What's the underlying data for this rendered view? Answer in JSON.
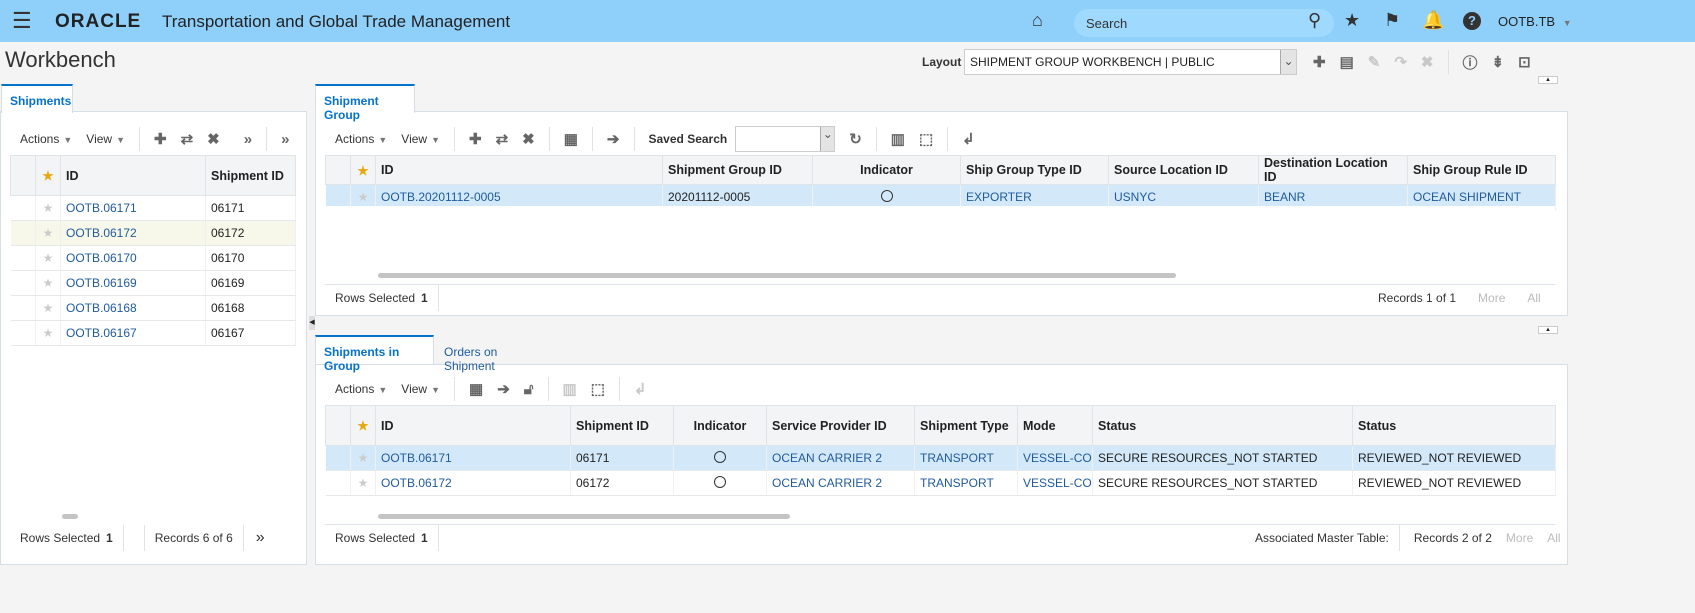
{
  "header": {
    "app_name": "Transportation and Global Trade Management",
    "logo": "ORACLE",
    "search_placeholder": "Search",
    "user": "OOTB.TB",
    "icons": [
      "menu-icon",
      "home-icon",
      "search-icon",
      "star-icon",
      "flag-icon",
      "bell-icon",
      "help-icon"
    ]
  },
  "page": {
    "title": "Workbench",
    "layout_label": "Layout",
    "layout_value": "SHIPMENT GROUP WORKBENCH | PUBLIC"
  },
  "left": {
    "tab": "Shipments",
    "actions": "Actions",
    "view": "View",
    "columns": [
      "ID",
      "Shipment ID"
    ],
    "rows": [
      [
        "OOTB.06171",
        "06171"
      ],
      [
        "OOTB.06172",
        "06172"
      ],
      [
        "OOTB.06170",
        "06170"
      ],
      [
        "OOTB.06169",
        "06169"
      ],
      [
        "OOTB.06168",
        "06168"
      ],
      [
        "OOTB.06167",
        "06167"
      ]
    ],
    "rows_selected_label": "Rows Selected",
    "rows_selected": "1",
    "records": "Records 6 of 6"
  },
  "group": {
    "tab": "Shipment Group",
    "actions": "Actions",
    "view": "View",
    "saved_search": "Saved Search",
    "columns": [
      "ID",
      "Shipment Group ID",
      "Indicator",
      "Ship Group Type ID",
      "Source Location ID",
      "Destination Location ID",
      "Ship Group Rule ID"
    ],
    "rows": [
      [
        "OOTB.20201112-0005",
        "20201112-0005",
        "",
        "EXPORTER",
        "USNYC",
        "BEANR",
        "OCEAN SHIPMENT"
      ]
    ],
    "rows_selected_label": "Rows Selected",
    "rows_selected": "1",
    "records": "Records 1 of 1",
    "more": "More",
    "all": "All"
  },
  "ingroup": {
    "tabs": [
      "Shipments in Group",
      "Orders on Shipment"
    ],
    "actions": "Actions",
    "view": "View",
    "columns": [
      "ID",
      "Shipment ID",
      "Indicator",
      "Service Provider ID",
      "Shipment Type",
      "Mode",
      "Status",
      "Status"
    ],
    "rows": [
      [
        "OOTB.06171",
        "06171",
        "",
        "OCEAN CARRIER 2",
        "TRANSPORT",
        "VESSEL-CO",
        "SECURE RESOURCES_NOT STARTED",
        "REVIEWED_NOT REVIEWED"
      ],
      [
        "OOTB.06172",
        "06172",
        "",
        "OCEAN CARRIER 2",
        "TRANSPORT",
        "VESSEL-CO",
        "SECURE RESOURCES_NOT STARTED",
        "REVIEWED_NOT REVIEWED"
      ]
    ],
    "rows_selected_label": "Rows Selected",
    "rows_selected": "1",
    "assoc": "Associated Master Table:",
    "records": "Records 2 of 2",
    "more": "More",
    "all": "All"
  },
  "colors": {
    "header_bg": "#8fd0fb",
    "link": "#1f5a9e",
    "selected_row": "#d3e9f9",
    "tab_accent": "#0572ce"
  }
}
